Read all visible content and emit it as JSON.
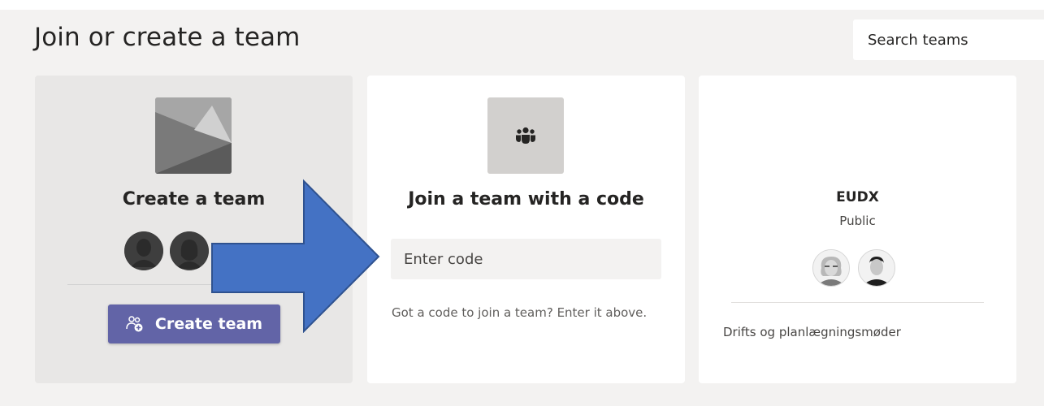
{
  "header": {
    "title": "Join or create a team",
    "search_placeholder": "Search teams"
  },
  "create_card": {
    "title": "Create a team",
    "button_label": "Create team",
    "illustration_icon": "landscape-placeholder-icon",
    "avatar_icons": [
      "person-silhouette-icon",
      "person-silhouette-icon"
    ]
  },
  "join_card": {
    "icon": "people-group-icon",
    "title": "Join a team with a code",
    "code_placeholder": "Enter code",
    "hint": "Got a code to join a team? Enter it above."
  },
  "team_card": {
    "name": "EUDX",
    "visibility": "Public",
    "description": "Drifts og planlægningsmøder",
    "member_avatars": [
      "member-avatar-1",
      "member-avatar-2"
    ]
  },
  "overlay": {
    "arrow_icon": "blue-right-arrow-annotation",
    "color": "#4472c4"
  },
  "colors": {
    "accent": "#6264a7",
    "background": "#f3f2f1",
    "card": "#ffffff",
    "create_card": "#e8e7e6"
  }
}
